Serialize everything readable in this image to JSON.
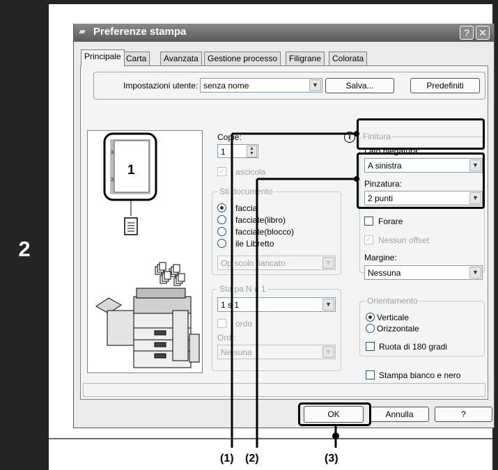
{
  "step_number": "2",
  "window": {
    "title": "Preferenze stampa",
    "help_glyph": "?",
    "close_glyph": "✕"
  },
  "tabs": [
    "Principale",
    "Carta",
    "Avanzata",
    "Gestione processo",
    "Filigrane",
    "Colorata"
  ],
  "user_settings": {
    "label": "Impostazioni utente:",
    "value": "senza nome",
    "save_label": "Salva...",
    "defaults_label": "Predefiniti"
  },
  "preview": {
    "page_number": "1"
  },
  "copies": {
    "label": "Copie:",
    "value": "1"
  },
  "collate": {
    "label": "Fascicola",
    "shown": "ascicola",
    "checked": true
  },
  "doc_style": {
    "label": "Stile documento",
    "shown_label": "Sti   documento",
    "options": [
      {
        "label": "1 facciata",
        "shown": "faccia",
        "selected": true
      },
      {
        "label": "2 facciate(libro)",
        "shown": "facciate(libro)",
        "selected": false
      },
      {
        "label": "2 facciate(blocco)",
        "shown": "facciate(blocco)",
        "selected": false
      },
      {
        "label": "Stile Libretto",
        "shown": "ile Libretto",
        "selected": false
      }
    ],
    "booklet_select": "Opuscolo affiancato",
    "booklet_shown": "Op   scolo   fiancato"
  },
  "n_up": {
    "label": "Stampa N-Su-1",
    "shown_label": "Sta  pa N    u 1",
    "select_value": "1 su 1",
    "select_shown": "1 s   1",
    "border_label": "Bordo",
    "border_shown": "ordo",
    "order_label": "Ordine:",
    "order_shown": "Ord   :",
    "order_value": "Nessuna",
    "order_shown_value": "Ne  suna"
  },
  "finishing": {
    "group_label": "Finitura",
    "binding_label": "Lato rilegatura:",
    "binding_value": "A sinistra",
    "staple_label": "Pinzatura:",
    "staple_value": "2 punti",
    "punch_label": "Forare",
    "offset_label": "Nessun offset",
    "margin_label": "Margine:",
    "margin_value": "Nessuna"
  },
  "orientation": {
    "label": "Orientamento",
    "portrait": "Verticale",
    "landscape": "Orizzontale",
    "rotate": "Ruota di 180 gradi"
  },
  "bw": {
    "label": "Stampa bianco e nero"
  },
  "buttons": {
    "ok": "OK",
    "cancel": "Annulla",
    "help": "?"
  },
  "callouts": [
    "(1)",
    "(2)",
    "(3)"
  ],
  "colors": {
    "frame": "#242424",
    "dialog_bg": "#f4f4f4",
    "titlebar": "#6e6e6e"
  }
}
